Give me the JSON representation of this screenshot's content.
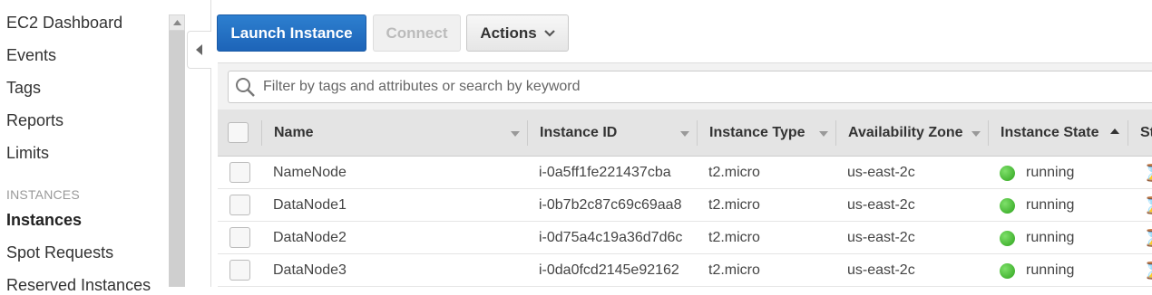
{
  "sidebar": {
    "items": [
      {
        "label": "EC2 Dashboard"
      },
      {
        "label": "Events"
      },
      {
        "label": "Tags"
      },
      {
        "label": "Reports"
      },
      {
        "label": "Limits"
      }
    ],
    "section_label": "INSTANCES",
    "section_items": [
      {
        "label": "Instances"
      },
      {
        "label": "Spot Requests"
      },
      {
        "label": "Reserved Instances"
      }
    ]
  },
  "toolbar": {
    "launch_label": "Launch Instance",
    "connect_label": "Connect",
    "actions_label": "Actions"
  },
  "search": {
    "placeholder": "Filter by tags and attributes or search by keyword"
  },
  "table": {
    "columns": [
      "Name",
      "Instance ID",
      "Instance Type",
      "Availability Zone",
      "Instance State",
      "St"
    ],
    "rows": [
      {
        "name": "NameNode",
        "id": "i-0a5ff1fe221437cba",
        "type": "t2.micro",
        "zone": "us-east-2c",
        "state": "running"
      },
      {
        "name": "DataNode1",
        "id": "i-0b7b2c87c69c69aa8",
        "type": "t2.micro",
        "zone": "us-east-2c",
        "state": "running"
      },
      {
        "name": "DataNode2",
        "id": "i-0d75a4c19a36d7d6c",
        "type": "t2.micro",
        "zone": "us-east-2c",
        "state": "running"
      },
      {
        "name": "DataNode3",
        "id": "i-0da0fcd2145e92162",
        "type": "t2.micro",
        "zone": "us-east-2c",
        "state": "running"
      }
    ]
  },
  "colors": {
    "primary": "#1d64b8",
    "running": "#2ea31d"
  },
  "icons": [
    "search-icon",
    "chevron-down-icon",
    "collapse-arrow-icon",
    "sort-caret-icon",
    "status-checks-icon"
  ]
}
